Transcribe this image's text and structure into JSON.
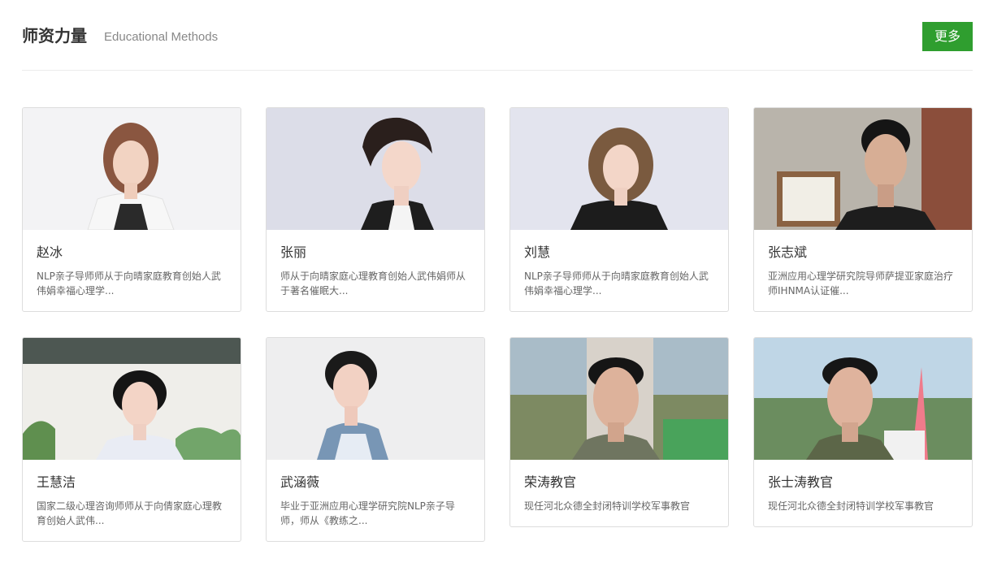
{
  "header": {
    "title": "师资力量",
    "subtitle": "Educational Methods",
    "more_label": "更多"
  },
  "colors": {
    "accent": "#2f9e2f",
    "border": "#dddddd",
    "text": "#333333",
    "muted": "#666666"
  },
  "teachers": [
    {
      "name": "赵冰",
      "desc": "NLP亲子导师师从于向晴家庭教育创始人武伟娟幸福心理学...",
      "photo_icon": "teacher-portrait"
    },
    {
      "name": "张丽",
      "desc": "师从于向晴家庭心理教育创始人武伟娟师从于著名催眠大...",
      "photo_icon": "teacher-portrait"
    },
    {
      "name": "刘慧",
      "desc": "NLP亲子导师师从于向晴家庭教育创始人武伟娟幸福心理学...",
      "photo_icon": "teacher-portrait"
    },
    {
      "name": "张志斌",
      "desc": "亚洲应用心理学研究院导师萨提亚家庭治疗师IHNMA认证催...",
      "photo_icon": "teacher-portrait"
    },
    {
      "name": "王慧洁",
      "desc": "国家二级心理咨询师师从于向倩家庭心理教育创始人武伟...",
      "photo_icon": "teacher-portrait"
    },
    {
      "name": "武涵薇",
      "desc": "毕业于亚洲应用心理学研究院NLP亲子导师，师从《教练之...",
      "photo_icon": "teacher-portrait"
    },
    {
      "name": "荣涛教官",
      "desc": "现任河北众德全封闭特训学校军事教官",
      "photo_icon": "teacher-portrait"
    },
    {
      "name": "张士涛教官",
      "desc": "现任河北众德全封闭特训学校军事教官",
      "photo_icon": "teacher-portrait"
    }
  ]
}
